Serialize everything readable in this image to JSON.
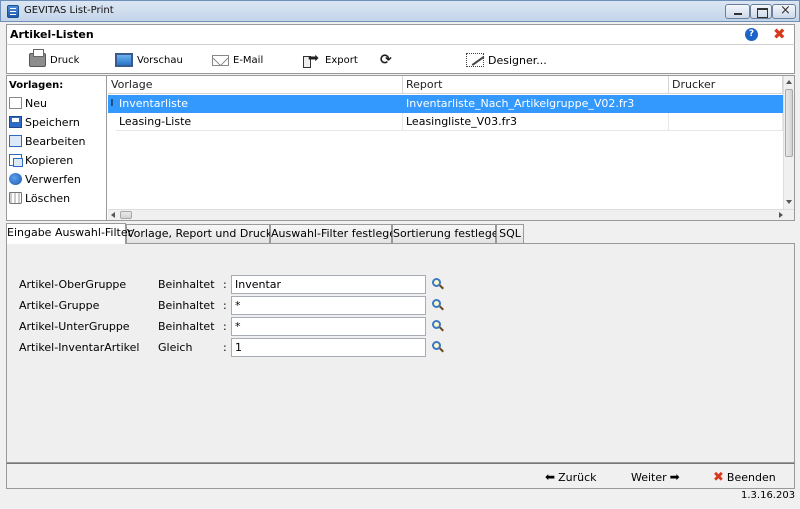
{
  "window": {
    "title": "GEVITAS List-Print"
  },
  "header": {
    "title": "Artikel-Listen"
  },
  "toolbar": {
    "print_label": "Druck",
    "preview_label": "Vorschau",
    "email_label": "E-Mail",
    "export_label": "Export",
    "designer_label": "Designer..."
  },
  "sidebar": {
    "heading": "Vorlagen:",
    "items": [
      "Neu",
      "Speichern",
      "Bearbeiten",
      "Kopieren",
      "Verwerfen",
      "Löschen"
    ]
  },
  "grid": {
    "columns": [
      "Vorlage",
      "Report",
      "Drucker"
    ],
    "row_marker": "I",
    "rows": [
      {
        "vorlage": "Inventarliste",
        "report": "Inventarliste_Nach_Artikelgruppe_V02.fr3",
        "drucker": "",
        "selected": true
      },
      {
        "vorlage": "Leasing-Liste",
        "report": "Leasingliste_V03.fr3",
        "drucker": "",
        "selected": false
      }
    ]
  },
  "tabs": [
    "Eingabe Auswahl-Filter",
    "Vorlage, Report und Drucker",
    "Auswahl-Filter festlegen",
    "Sortierung festlegen",
    "SQL"
  ],
  "filters": [
    {
      "label": "Artikel-OberGruppe",
      "operator": "Beinhaltet",
      "value": "Inventar"
    },
    {
      "label": "Artikel-Gruppe",
      "operator": "Beinhaltet",
      "value": "*"
    },
    {
      "label": "Artikel-UnterGruppe",
      "operator": "Beinhaltet",
      "value": "*"
    },
    {
      "label": "Artikel-InventarArtikel",
      "operator": "Gleich",
      "value": "1"
    }
  ],
  "colon": ":",
  "footer": {
    "back_label": "Zurück",
    "next_label": "Weiter",
    "finish_label": "Beenden",
    "version": "1.3.16.203"
  },
  "colors": {
    "selection": "#3399ff",
    "accent_red": "#d8381c",
    "help_blue": "#1d64c8"
  },
  "icons": [
    "app-icon",
    "printer-icon",
    "monitor-icon",
    "mail-icon",
    "export-icon",
    "refresh-icon",
    "designer-icon",
    "help-icon",
    "close-icon",
    "new-icon",
    "save-icon",
    "edit-icon",
    "copy-icon",
    "discard-icon",
    "trash-icon",
    "magnifier-icon",
    "arrow-left-icon",
    "arrow-right-icon",
    "x-icon"
  ]
}
